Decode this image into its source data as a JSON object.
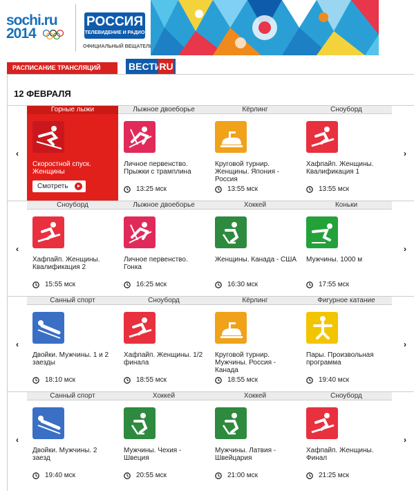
{
  "banner": {
    "logo_line1": "sochi.ru",
    "logo_line2": "2014",
    "broadcaster_name": "РОССИЯ",
    "broadcaster_sub": "ТЕЛЕВИДЕНИЕ И РАДИО",
    "official_label": "ОФИЦИАЛЬНЫЙ ВЕЩАТЕЛЬ"
  },
  "tabs": {
    "schedule_label": "РАСПИСАНИЕ ТРАНСЛЯЦИЙ",
    "vesti_label": "ВЕСТИ",
    "vesti_ru_label": "RU"
  },
  "date_heading": "12 ФЕВРАЛЯ",
  "nav": {
    "prev": "‹",
    "next": "›"
  },
  "watch_label": "Смотреть",
  "colors": {
    "red": "#e1201c",
    "pink": "#e02a5a",
    "orange": "#f0a21a",
    "green": "#2d8a3e",
    "blue": "#3a6fc4",
    "yellow": "#f2c500",
    "brightgreen": "#23a23a"
  },
  "rows": [
    {
      "cards": [
        {
          "sport": "Горные лыжи",
          "event": "Скоростной спуск. Женщины",
          "time": "",
          "icon": "alpine-skiing-icon",
          "color": "#c9171d",
          "active": true
        },
        {
          "sport": "Лыжное двоеборье",
          "event": "Личное первенство. Прыжки с трамплина",
          "time": "13:25 мск",
          "icon": "nordic-combined-icon",
          "color": "#e02a5a"
        },
        {
          "sport": "Кёрлинг",
          "event": "Круговой турнир. Женщины. Япония - Россия",
          "time": "13:55 мск",
          "icon": "curling-icon",
          "color": "#f0a21a"
        },
        {
          "sport": "Сноуборд",
          "event": "Хафпайп. Женщины. Квалификация 1",
          "time": "13:55 мск",
          "icon": "snowboard-icon",
          "color": "#e8303f"
        }
      ]
    },
    {
      "cards": [
        {
          "sport": "Сноуборд",
          "event": "Хафпайп. Женщины. Квалификация 2",
          "time": "15:55 мск",
          "icon": "snowboard-icon",
          "color": "#e8303f"
        },
        {
          "sport": "Лыжное двоеборье",
          "event": "Личное первенство. Гонка",
          "time": "16:25 мск",
          "icon": "nordic-combined-icon",
          "color": "#e02a5a"
        },
        {
          "sport": "Хоккей",
          "event": "Женщины. Канада - США",
          "time": "16:30 мск",
          "icon": "hockey-icon",
          "color": "#2d8a3e"
        },
        {
          "sport": "Коньки",
          "event": "Мужчины. 1000 м",
          "time": "17:55 мск",
          "icon": "speed-skating-icon",
          "color": "#23a23a"
        }
      ]
    },
    {
      "cards": [
        {
          "sport": "Санный спорт",
          "event": "Двойки. Мужчины. 1 и 2 заезды",
          "time": "18:10 мск",
          "icon": "luge-icon",
          "color": "#3a6fc4"
        },
        {
          "sport": "Сноуборд",
          "event": "Хафпайп. Женщины. 1/2 финала",
          "time": "18:55 мск",
          "icon": "snowboard-icon",
          "color": "#e8303f"
        },
        {
          "sport": "Кёрлинг",
          "event": "Круговой турнир. Мужчины. Россия - Канада",
          "time": "18:55 мск",
          "icon": "curling-icon",
          "color": "#f0a21a"
        },
        {
          "sport": "Фигурное катание",
          "event": "Пары. Произвольная программа",
          "time": "19:40 мск",
          "icon": "figure-skating-icon",
          "color": "#f2c500"
        }
      ]
    },
    {
      "cards": [
        {
          "sport": "Санный спорт",
          "event": "Двойки. Мужчины. 2 заезд",
          "time": "19:40 мск",
          "icon": "luge-icon",
          "color": "#3a6fc4"
        },
        {
          "sport": "Хоккей",
          "event": "Мужчины. Чехия - Швеция",
          "time": "20:55 мск",
          "icon": "hockey-icon",
          "color": "#2d8a3e"
        },
        {
          "sport": "Хоккей",
          "event": "Мужчины. Латвия - Швейцария",
          "time": "21:00 мск",
          "icon": "hockey-icon",
          "color": "#2d8a3e"
        },
        {
          "sport": "Сноуборд",
          "event": "Хафпайп. Женщины. Финал",
          "time": "21:25 мск",
          "icon": "snowboard-icon",
          "color": "#e8303f"
        }
      ]
    }
  ]
}
